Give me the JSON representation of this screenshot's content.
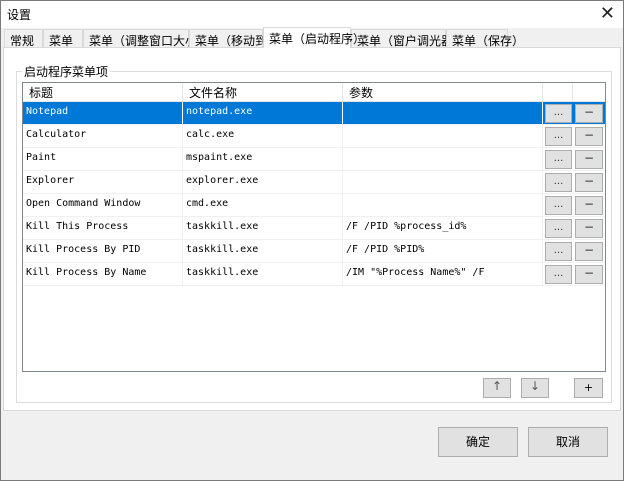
{
  "window": {
    "title": "设置",
    "close_icon": "close-icon"
  },
  "tabs": [
    {
      "label": "常规"
    },
    {
      "label": "菜单"
    },
    {
      "label": "菜单（调整窗口大小）"
    },
    {
      "label": "菜单（移动到）"
    },
    {
      "label": "菜单（启动程序）",
      "active": true
    },
    {
      "label": "菜单（窗户调光器）"
    },
    {
      "label": "菜单（保存）"
    }
  ],
  "group": {
    "label": "启动程序菜单项"
  },
  "table": {
    "headers": [
      "标题",
      "文件名称",
      "参数"
    ],
    "edit_label": "...",
    "remove_label": "−",
    "rows": [
      {
        "title": "Notepad",
        "file": "notepad.exe",
        "args": ""
      },
      {
        "title": "Calculator",
        "file": "calc.exe",
        "args": ""
      },
      {
        "title": "Paint",
        "file": "mspaint.exe",
        "args": ""
      },
      {
        "title": "Explorer",
        "file": "explorer.exe",
        "args": ""
      },
      {
        "title": "Open Command Window",
        "file": "cmd.exe",
        "args": ""
      },
      {
        "title": "Kill This Process",
        "file": "taskkill.exe",
        "args": "/F /PID %process_id%"
      },
      {
        "title": "Kill Process By PID",
        "file": "taskkill.exe",
        "args": "/F /PID %PID%"
      },
      {
        "title": "Kill Process By Name",
        "file": "taskkill.exe",
        "args": "/IM \"%Process Name%\" /F"
      }
    ]
  },
  "controls": {
    "up": "↑",
    "down": "↓",
    "add": "+"
  },
  "footer": {
    "ok": "确定",
    "cancel": "取消"
  },
  "colors": {
    "selection": "#0078d7"
  }
}
